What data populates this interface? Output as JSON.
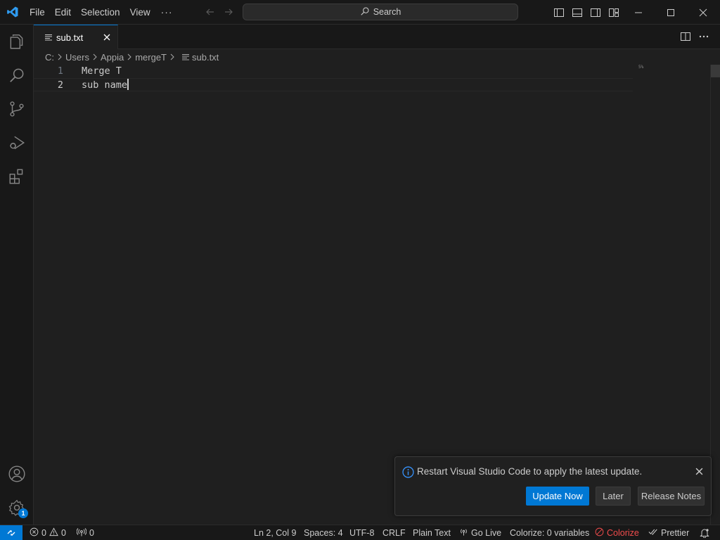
{
  "menu": {
    "file": "File",
    "edit": "Edit",
    "selection": "Selection",
    "view": "View",
    "more": "···"
  },
  "search": {
    "label": "Search"
  },
  "tab": {
    "label": "sub.txt",
    "icon": "lines-icon"
  },
  "breadcrumb": [
    "C:",
    "Users",
    "Appia",
    "mergeT",
    "sub.txt"
  ],
  "editor": {
    "lines": [
      {
        "number": "1",
        "text": "Merge T"
      },
      {
        "number": "2",
        "text": "sub name"
      }
    ],
    "minimap_mark": "5%"
  },
  "activity": {
    "settings_badge": "1",
    "icons": [
      "explorer-icon",
      "search-icon",
      "source-control-icon",
      "run-debug-icon",
      "extensions-icon",
      "account-icon",
      "manage-gear-icon"
    ]
  },
  "notification": {
    "message": "Restart Visual Studio Code to apply the latest update.",
    "update_now": "Update Now",
    "later": "Later",
    "release_notes": "Release Notes"
  },
  "status": {
    "errors": "0",
    "warnings": "0",
    "ports": "0",
    "position": "Ln 2, Col 9",
    "spaces": "Spaces: 4",
    "encoding": "UTF-8",
    "eol": "CRLF",
    "language": "Plain Text",
    "go_live": "Go Live",
    "colorize_vars": "Colorize: 0 variables",
    "colorize": "Colorize",
    "prettier": "Prettier"
  },
  "colors": {
    "accent": "#0078d4",
    "background": "#1f1f1f",
    "chrome": "#181818",
    "error_red": "#f14c4c"
  }
}
